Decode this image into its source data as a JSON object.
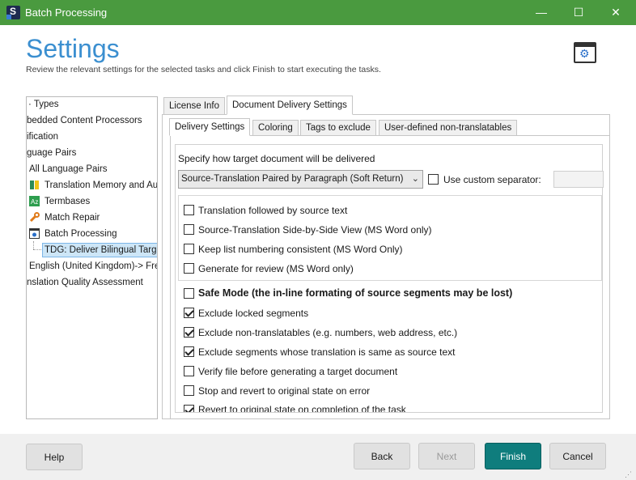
{
  "window": {
    "title": "Batch Processing",
    "minimize": "—",
    "maximize": "☐",
    "close": "✕"
  },
  "header": {
    "title": "Settings",
    "subtitle": "Review the relevant settings for the selected tasks and click Finish to start executing the tasks."
  },
  "tree": {
    "items": [
      {
        "label": "· Types"
      },
      {
        "label": "bedded Content Processors"
      },
      {
        "label": "ification"
      },
      {
        "label": "guage Pairs"
      },
      {
        "label": "All Language Pairs"
      },
      {
        "label": "Translation Memory and Au"
      },
      {
        "label": "Termbases"
      },
      {
        "label": "Match Repair"
      },
      {
        "label": "Batch Processing"
      },
      {
        "label": "TDG: Deliver Bilingual Targe"
      },
      {
        "label": "English (United Kingdom)-> Fre"
      },
      {
        "label": "nslation Quality Assessment"
      }
    ]
  },
  "tabs_top": [
    {
      "label": "License Info"
    },
    {
      "label": "Document Delivery Settings"
    }
  ],
  "tabs_sub": [
    {
      "label": "Delivery Settings"
    },
    {
      "label": "Coloring"
    },
    {
      "label": "Tags to exclude"
    },
    {
      "label": "User-defined non-translatables"
    }
  ],
  "delivery": {
    "prompt": "Specify how target document will be delivered",
    "dropdown_value": "Source-Translation Paired by Paragraph (Soft Return)",
    "custom_separator_label": "Use custom separator:",
    "options_group": [
      {
        "label": "Translation followed by source text",
        "checked": false
      },
      {
        "label": "Source-Translation Side-by-Side View (MS Word only)",
        "checked": false
      },
      {
        "label": "Keep list numbering consistent (MS Word Only)",
        "checked": false
      },
      {
        "label": "Generate for review (MS Word only)",
        "checked": false
      }
    ],
    "safe_mode": "Safe Mode (the in-line formating of source segments may be lost)",
    "options": [
      {
        "label": "Exclude locked segments",
        "checked": true
      },
      {
        "label": "Exclude non-translatables (e.g. numbers, web address, etc.)",
        "checked": true
      },
      {
        "label": "Exclude segments whose translation is same as source text",
        "checked": true
      },
      {
        "label": "Verify file before generating a target document",
        "checked": false
      },
      {
        "label": "Stop and revert to original state on error",
        "checked": false
      },
      {
        "label": "Revert to original state on completion of the task",
        "checked": true
      }
    ]
  },
  "footer": {
    "help": "Help",
    "back": "Back",
    "next": "Next",
    "finish": "Finish",
    "cancel": "Cancel"
  },
  "colors": {
    "titlebar": "#4a9a3f",
    "heading": "#3b8fd0",
    "finish": "#0f7d7d"
  }
}
